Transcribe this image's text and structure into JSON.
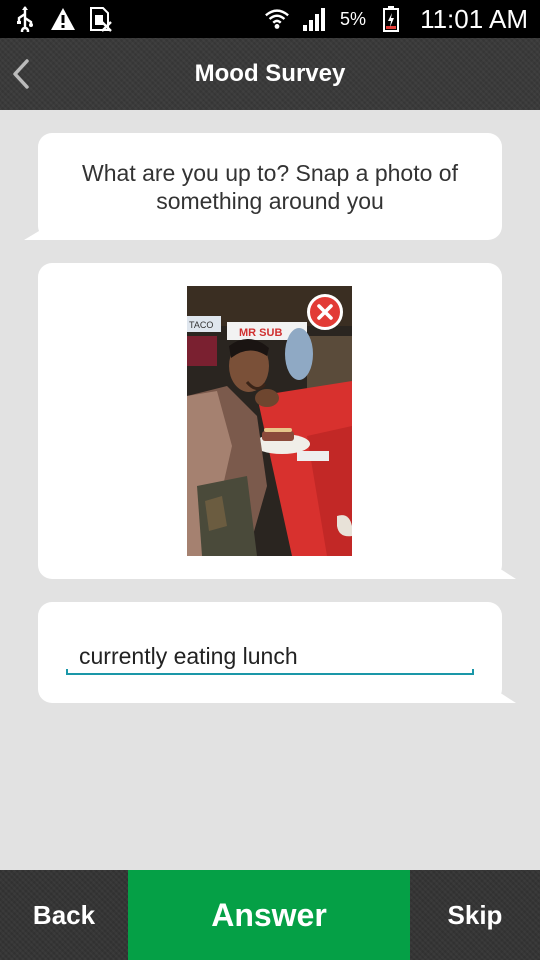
{
  "status_bar": {
    "battery_percent": "5%",
    "time": "11:01 AM",
    "icons": [
      "usb-icon",
      "warning-icon",
      "no-sim-icon",
      "wifi-icon",
      "signal-icon",
      "battery-icon"
    ]
  },
  "app_bar": {
    "title": "Mood Survey",
    "back_icon": "chevron-left-icon"
  },
  "question": {
    "text": "What are you up to? Snap a photo of something around you"
  },
  "photo": {
    "remove_icon": "close-icon",
    "sign_text_1": "TACO",
    "sign_text_2": "MR SUB"
  },
  "answer": {
    "value": "currently eating lunch"
  },
  "bottom_bar": {
    "back_label": "Back",
    "answer_label": "Answer",
    "skip_label": "Skip"
  },
  "colors": {
    "accent_green": "#05a046",
    "input_underline": "#1a97a8",
    "remove_red": "#e23b36"
  }
}
